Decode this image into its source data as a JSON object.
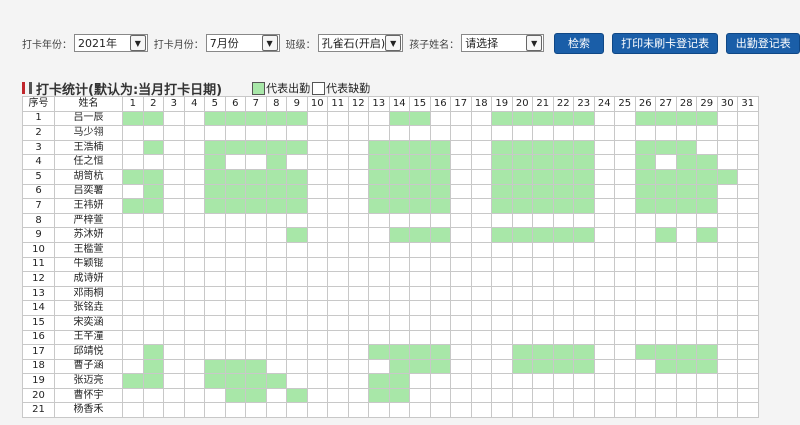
{
  "filters": {
    "year_label": "打卡年份：",
    "year_value": "2021年",
    "month_label": "打卡月份：",
    "month_value": "7月份",
    "class_label": "班级：",
    "class_value": "孔雀石(开启)",
    "child_label": "孩子姓名：",
    "child_value": "请选择"
  },
  "buttons": {
    "search": "检索",
    "print_missing": "打印未刷卡登记表",
    "attendance_register": "出勤登记表"
  },
  "section": {
    "title": "打卡统计(默认为:当月打卡日期)",
    "legend_present": "代表出勤",
    "legend_absent": "代表缺勤"
  },
  "colors": {
    "present": "#a8e7a8",
    "button": "#1a5ea8",
    "title_marker": "#c0262c"
  },
  "table": {
    "col_no": "序号",
    "col_name": "姓名",
    "days": [
      "1",
      "2",
      "3",
      "4",
      "5",
      "6",
      "7",
      "8",
      "9",
      "10",
      "11",
      "12",
      "13",
      "14",
      "15",
      "16",
      "17",
      "18",
      "19",
      "20",
      "21",
      "22",
      "23",
      "24",
      "25",
      "26",
      "27",
      "28",
      "29",
      "30",
      "31"
    ],
    "rows": [
      {
        "no": "1",
        "name": "吕一辰",
        "present": [
          1,
          2,
          5,
          6,
          7,
          8,
          9,
          14,
          15,
          19,
          20,
          21,
          22,
          23,
          26,
          27,
          28,
          29
        ]
      },
      {
        "no": "2",
        "name": "马少翎",
        "present": []
      },
      {
        "no": "3",
        "name": "王浩楠",
        "present": [
          2,
          5,
          6,
          7,
          8,
          9,
          13,
          14,
          15,
          16,
          19,
          20,
          21,
          22,
          23,
          26,
          27,
          28
        ]
      },
      {
        "no": "4",
        "name": "任之恒",
        "present": [
          5,
          8,
          13,
          14,
          15,
          16,
          19,
          20,
          21,
          22,
          23,
          26,
          28,
          29
        ]
      },
      {
        "no": "5",
        "name": "胡笥杭",
        "present": [
          1,
          2,
          5,
          6,
          7,
          8,
          9,
          13,
          14,
          15,
          16,
          19,
          20,
          21,
          22,
          23,
          26,
          27,
          28,
          29,
          30
        ]
      },
      {
        "no": "6",
        "name": "吕奕薯",
        "present": [
          2,
          5,
          6,
          7,
          8,
          9,
          13,
          14,
          15,
          16,
          19,
          20,
          21,
          22,
          23,
          26,
          27,
          28,
          29
        ]
      },
      {
        "no": "7",
        "name": "王祎妍",
        "present": [
          1,
          2,
          5,
          6,
          7,
          8,
          9,
          13,
          14,
          15,
          16,
          19,
          20,
          21,
          22,
          23,
          26,
          27,
          28,
          29
        ]
      },
      {
        "no": "8",
        "name": "严梓萱",
        "present": []
      },
      {
        "no": "9",
        "name": "苏沐妍",
        "present": [
          9,
          14,
          15,
          16,
          19,
          20,
          21,
          22,
          23,
          27,
          29
        ]
      },
      {
        "no": "10",
        "name": "王槛萱",
        "present": []
      },
      {
        "no": "11",
        "name": "牛颖锟",
        "present": []
      },
      {
        "no": "12",
        "name": "成诗妍",
        "present": []
      },
      {
        "no": "13",
        "name": "邓雨桐",
        "present": []
      },
      {
        "no": "14",
        "name": "张铭垚",
        "present": []
      },
      {
        "no": "15",
        "name": "宋奕涵",
        "present": []
      },
      {
        "no": "16",
        "name": "王芊潼",
        "present": []
      },
      {
        "no": "17",
        "name": "邱靖悦",
        "present": [
          2,
          13,
          14,
          15,
          16,
          20,
          21,
          22,
          23,
          26,
          27,
          28,
          29
        ]
      },
      {
        "no": "18",
        "name": "曹子涵",
        "present": [
          2,
          5,
          6,
          7,
          14,
          15,
          16,
          20,
          21,
          22,
          23,
          27,
          28,
          29
        ]
      },
      {
        "no": "19",
        "name": "张迈亮",
        "present": [
          1,
          2,
          5,
          6,
          7,
          8,
          13,
          14
        ]
      },
      {
        "no": "20",
        "name": "曹怀宇",
        "present": [
          6,
          7,
          9,
          13,
          14
        ]
      },
      {
        "no": "21",
        "name": "杨香禾",
        "present": []
      }
    ]
  }
}
